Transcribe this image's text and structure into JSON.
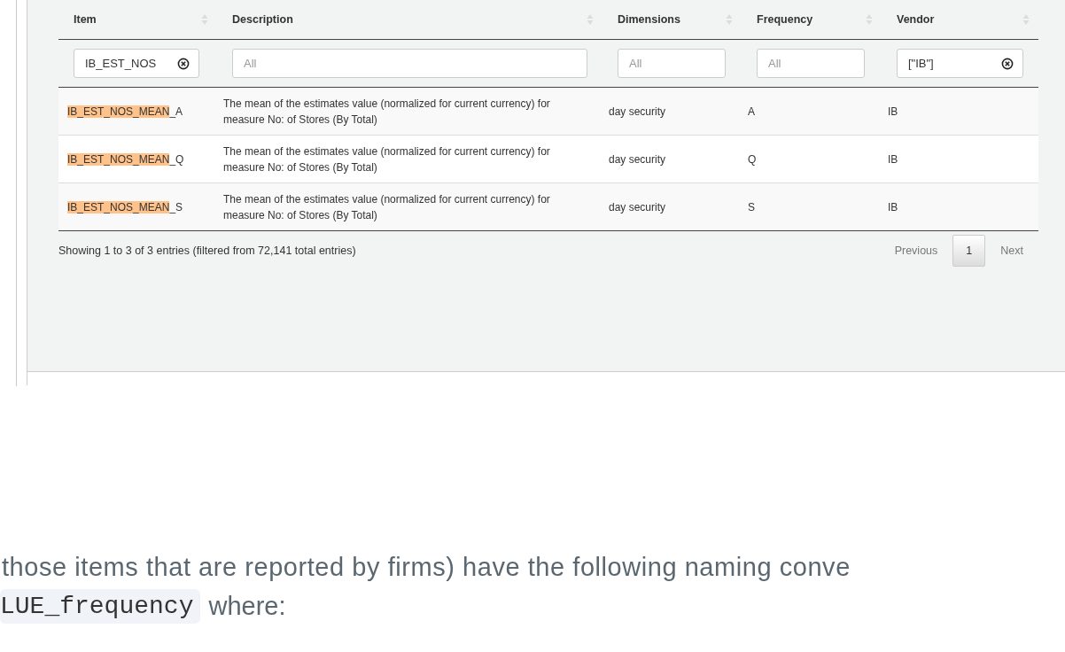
{
  "table": {
    "columns": [
      {
        "title": "Item"
      },
      {
        "title": "Description"
      },
      {
        "title": "Dimensions"
      },
      {
        "title": "Frequency"
      },
      {
        "title": "Vendor"
      }
    ],
    "filters": [
      {
        "value": "IB_EST_NOS"
      },
      {
        "placeholder": "All"
      },
      {
        "placeholder": "All"
      },
      {
        "placeholder": "All"
      },
      {
        "value": "[\"IB\"]"
      }
    ],
    "rows": [
      {
        "item": {
          "match": "IB_EST_NOS_MEAN",
          "rest": "_A"
        },
        "description": "The mean of the estimates value (normalized for current currency) for measure No: of Stores (By Total)",
        "dimensions": "day security",
        "frequency": "A",
        "vendor": "IB"
      },
      {
        "item": {
          "match": "IB_EST_NOS_MEAN",
          "rest": "_Q"
        },
        "description": "The mean of the estimates value (normalized for current currency) for measure No: of Stores (By Total)",
        "dimensions": "day security",
        "frequency": "Q",
        "vendor": "IB"
      },
      {
        "item": {
          "match": "IB_EST_NOS_MEAN",
          "rest": "_S"
        },
        "description": "The mean of the estimates value (normalized for current currency) for measure No: of Stores (By Total)",
        "dimensions": "day security",
        "frequency": "S",
        "vendor": "IB"
      }
    ],
    "info": "Showing 1 to 3 of 3 entries (filtered from 72,141 total entries)",
    "pagination": {
      "previous": "Previous",
      "pages": [
        {
          "label": "1",
          "selected": true
        }
      ],
      "next": "Next"
    }
  },
  "text": {
    "line": "those items that are reported by firms) have the following naming conve",
    "code": "LUE_frequency",
    "after": "where:"
  }
}
